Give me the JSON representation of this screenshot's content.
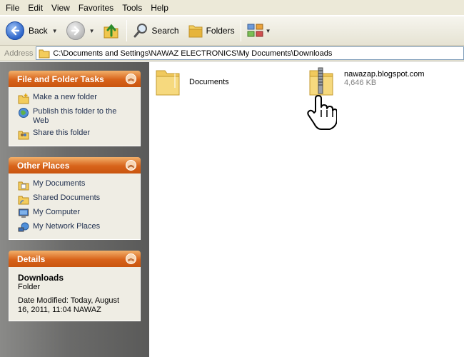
{
  "menu": [
    "File",
    "Edit",
    "View",
    "Favorites",
    "Tools",
    "Help"
  ],
  "toolbar": {
    "back_label": "Back",
    "search_label": "Search",
    "folders_label": "Folders"
  },
  "address": {
    "label": "Address",
    "path": "C:\\Documents and Settings\\NAWAZ ELECTRONICS\\My Documents\\Downloads"
  },
  "tasks_panel": {
    "title": "File and Folder Tasks",
    "items": [
      {
        "label": "Make a new folder",
        "icon": "new-folder-icon"
      },
      {
        "label": "Publish this folder to the Web",
        "icon": "publish-web-icon"
      },
      {
        "label": "Share this folder",
        "icon": "share-folder-icon"
      }
    ]
  },
  "places_panel": {
    "title": "Other Places",
    "items": [
      {
        "label": "My Documents",
        "icon": "my-documents-icon"
      },
      {
        "label": "Shared Documents",
        "icon": "shared-documents-icon"
      },
      {
        "label": "My Computer",
        "icon": "my-computer-icon"
      },
      {
        "label": "My Network Places",
        "icon": "network-places-icon"
      }
    ]
  },
  "details_panel": {
    "title": "Details",
    "name": "Downloads",
    "type": "Folder",
    "modified_line1": "Date Modified: Today, August",
    "modified_line2": "16, 2011, 11:04 NAWAZ"
  },
  "files": [
    {
      "name": "Documents",
      "icon": "folder-icon"
    },
    {
      "name": "nawazap.blogspot.com",
      "size": "4,646 KB",
      "icon": "zip-folder-icon"
    }
  ],
  "colors": {
    "panel_header": "#d8631a",
    "taskpane_bg": "#6b6b6a",
    "link_text": "#20304f"
  }
}
